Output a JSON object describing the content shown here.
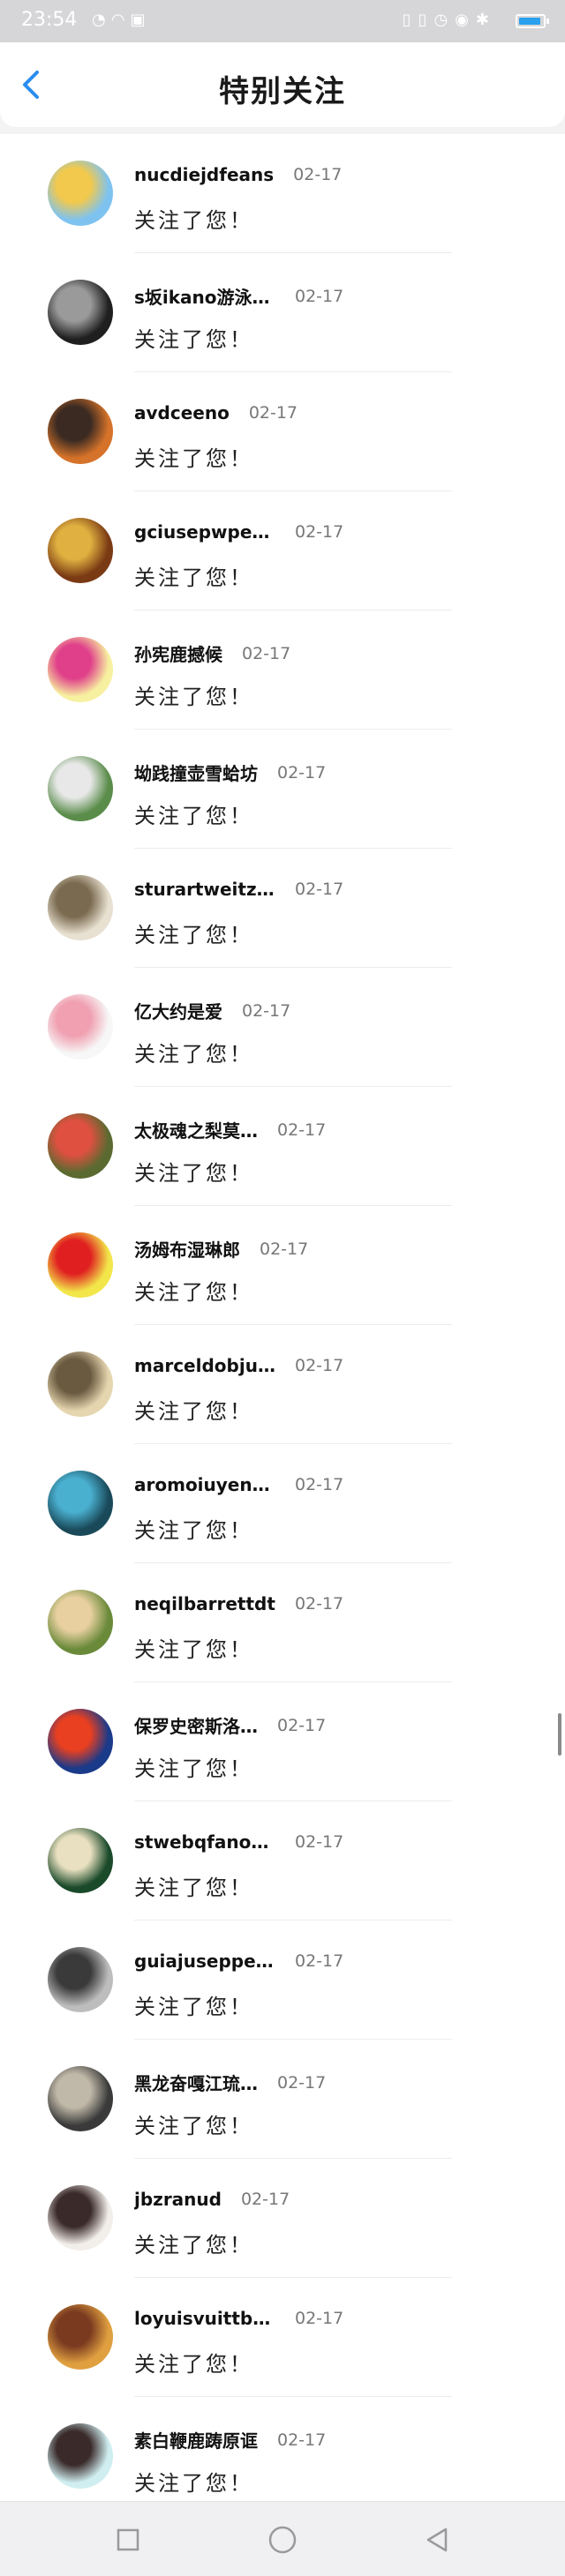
{
  "status_bar": {
    "time": "23:54",
    "left_icons": [
      "notification-icon",
      "wifi-icon",
      "image-icon"
    ],
    "right_icons": [
      "vibrate-icon",
      "vibrate-icon",
      "alarm-icon",
      "eye-icon",
      "bluetooth-icon"
    ],
    "battery_color": "#2aa0ef"
  },
  "header": {
    "title": "特别关注",
    "back_icon": "back-arrow-icon",
    "accent": "#2a8df0"
  },
  "items": [
    {
      "name": "nucdiejdfeans",
      "date": "02-17",
      "message": "关注了您！"
    },
    {
      "name": "s坂ikano游泳咒…",
      "date": "02-17",
      "message": "关注了您！"
    },
    {
      "name": "avdceeno",
      "date": "02-17",
      "message": "关注了您！"
    },
    {
      "name": "gciusepwpezadn…",
      "date": "02-17",
      "message": "关注了您！"
    },
    {
      "name": "孙宪鹿撼候",
      "date": "02-17",
      "message": "关注了您！"
    },
    {
      "name": "坳践撞壶雪蛤坊",
      "date": "02-17",
      "message": "关注了您！"
    },
    {
      "name": "sturartweitzmant",
      "date": "02-17",
      "message": "关注了您！"
    },
    {
      "name": "亿大约是爱",
      "date": "02-17",
      "message": "关注了您！"
    },
    {
      "name": "太极魂之梨莫…",
      "date": "02-17",
      "message": "关注了您！"
    },
    {
      "name": "汤姆布湿琳郎",
      "date": "02-17",
      "message": "关注了您！"
    },
    {
      "name": "marceldobjurlon",
      "date": "02-17",
      "message": "关注了您！"
    },
    {
      "name": "aromoiuyenssss",
      "date": "02-17",
      "message": "关注了您！"
    },
    {
      "name": "neqilbarrettdt",
      "date": "02-17",
      "message": "关注了您！"
    },
    {
      "name": "保罗史密斯洛…",
      "date": "02-17",
      "message": "关注了您！"
    },
    {
      "name": "stwebqfanoricci",
      "date": "02-17",
      "message": "关注了您！"
    },
    {
      "name": "guiajuseppezano…",
      "date": "02-17",
      "message": "关注了您！"
    },
    {
      "name": "黑龙奋嘎江琉…",
      "date": "02-17",
      "message": "关注了您！"
    },
    {
      "name": "jbzranud",
      "date": "02-17",
      "message": "关注了您！"
    },
    {
      "name": "loyuisvuittbcon",
      "date": "02-17",
      "message": "关注了您！"
    },
    {
      "name": "素白鞭鹿踌原诓",
      "date": "02-17",
      "message": "关注了您！"
    }
  ],
  "avatar_colors": [
    [
      "#7ec3f0",
      "#f2c94c"
    ],
    [
      "#1f1f1f",
      "#9a9a9a"
    ],
    [
      "#d6732a",
      "#3a2a22"
    ],
    [
      "#7a3a14",
      "#e0b040"
    ],
    [
      "#f7f0a0",
      "#e0408a"
    ],
    [
      "#5a8c4a",
      "#e8e8e8"
    ],
    [
      "#e8e0d0",
      "#7a6a50"
    ],
    [
      "#f7f7f7",
      "#f0a0b0"
    ],
    [
      "#5a6a30",
      "#e05040"
    ],
    [
      "#f2e64a",
      "#e02020"
    ],
    [
      "#e6d6b0",
      "#6a5a40"
    ],
    [
      "#1a4a5a",
      "#4ab0d0"
    ],
    [
      "#6a8a3a",
      "#e8d0a0"
    ],
    [
      "#1a3a8a",
      "#e84020"
    ],
    [
      "#1a4a2a",
      "#e8e0c0"
    ],
    [
      "#bdbdbd",
      "#3a3a3a"
    ],
    [
      "#3a3a3a",
      "#c0b8a8"
    ],
    [
      "#f2eeea",
      "#3a2a2a"
    ],
    [
      "#e0a040",
      "#7a3a20"
    ],
    [
      "#d0eef0",
      "#3a2a2a"
    ]
  ],
  "nav_bar": {
    "buttons": [
      "recents-square-icon",
      "home-circle-icon",
      "back-triangle-icon"
    ]
  }
}
